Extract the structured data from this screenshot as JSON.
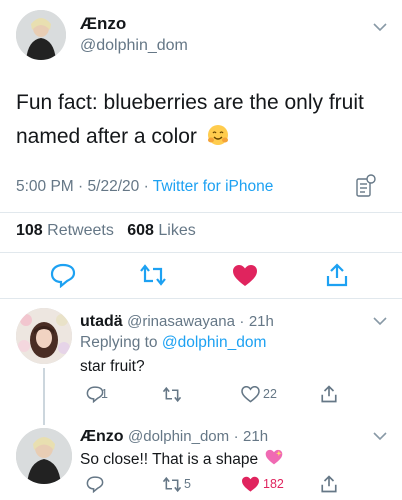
{
  "main_tweet": {
    "display_name": "Ænzo",
    "handle": "@dolphin_dom",
    "text": "Fun fact: blueberries are the only fruit named after a color",
    "text_line1": "Fun fact: blueberries are the only fruit",
    "text_line2": "named after a color",
    "emoji": "hugging-face-emoji",
    "time": "5:00 PM",
    "date": "5/22/20",
    "source": "Twitter for iPhone",
    "retweets_count": "108",
    "retweets_label": "Retweets",
    "likes_count": "608",
    "likes_label": "Likes"
  },
  "replies": [
    {
      "display_name": "utadä",
      "handle": "@rinasawayana",
      "time": "21h",
      "replying_label": "Replying to",
      "replying_handle": "@dolphin_dom",
      "text": "star fruit?",
      "reply_count": "1",
      "retweet_count": "",
      "like_count": "22"
    },
    {
      "display_name": "Ænzo",
      "handle": "@dolphin_dom",
      "time": "21h",
      "text": "So close!! That is a shape",
      "emoji": "sparkling-heart-emoji",
      "reply_count": "",
      "retweet_count": "5",
      "like_count": "182"
    }
  ],
  "colors": {
    "link": "#1da1f2",
    "secondary_text": "#657786",
    "like_red": "#e0245e",
    "divider": "#e1e8ed"
  },
  "sep": "·"
}
